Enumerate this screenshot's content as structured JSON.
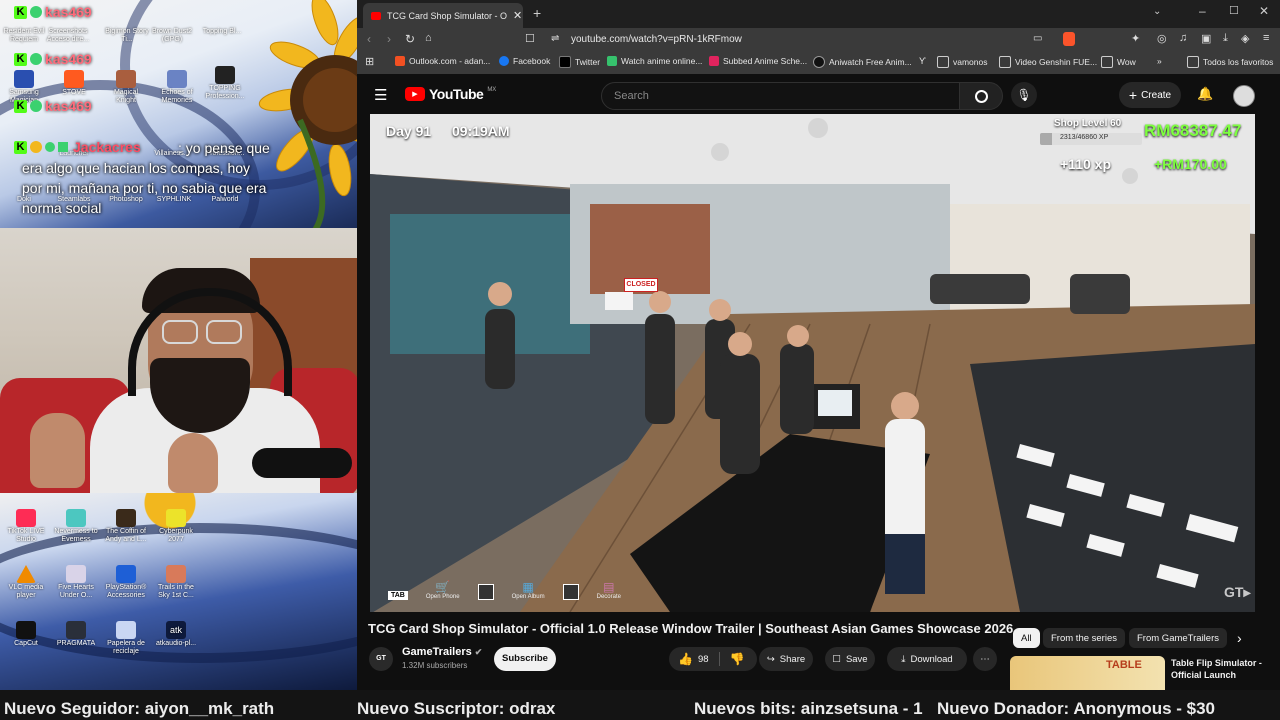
{
  "stream_overlay": {
    "chat": [
      {
        "badge": "K",
        "user": "kas469"
      },
      {
        "badge": "K",
        "user": "kas469"
      },
      {
        "badge": "K",
        "user": "kas469"
      },
      {
        "badge": "K",
        "user": "Jackacres",
        "message": ": yo pense que era algo que hacian los compas, hoy por mi, mañana por ti, no sabia que era norma social"
      }
    ],
    "desktop_icons_top": [
      "Resident Evil Requiem",
      "Screenshots Acceso dire...",
      "Bigimon Story Ti...",
      "Brown Dust2 (GPG)",
      "Topping Bl...",
      "Samsung Magician",
      "STOVE",
      "Magical Knight",
      "Echoes of Memories",
      "TOPPING Profession...",
      "Launcher",
      "Villainess...",
      "Profession...",
      "Doki",
      "Steamlabs",
      "Photoshop",
      "SYPHLINK",
      "Palworld"
    ],
    "desktop_icons_bottom": [
      "TikTok LIVE Studio",
      "Nevermess to Everness",
      "The Coffin of Andy and L...",
      "Cyberpunk 2077",
      "VLC media player",
      "Five Hearts Under O...",
      "PlayStation® Accessories",
      "Trails in the Sky 1st C...",
      "CapCut",
      "PRAGMATA",
      "Papelera de reciclaje",
      "atkaudio-pl..."
    ]
  },
  "browser": {
    "tab_title": "TCG Card Shop Simulator - Offic",
    "url": "youtube.com/watch?v=pRN-1kRFmow",
    "bookmarks": [
      "Outlook.com - adan...",
      "Facebook",
      "Twitter",
      "Watch anime online...",
      "Subbed Anime Sche...",
      "Aniwatch Free Anim...",
      "vamonos",
      "Video Genshin FUE...",
      "Wow"
    ],
    "bookmarks_right": "Todos los favoritos",
    "colors": {
      "youtube_red": "#ff0000",
      "game_green": "#7dff3f"
    }
  },
  "youtube": {
    "logo": "YouTube",
    "region": "MX",
    "search_placeholder": "Search",
    "create_label": "Create",
    "video": {
      "title": "TCG Card Shop Simulator - Official 1.0 Release Window Trailer | Southeast Asian Games Showcase 2026",
      "channel": "GameTrailers",
      "subscribers": "1.32M subscribers",
      "subscribe_label": "Subscribe",
      "likes": "98",
      "share_label": "Share",
      "save_label": "Save",
      "download_label": "Download",
      "watermark": "GT▸"
    },
    "game_hud": {
      "day": "Day 91",
      "time": "09:19AM",
      "shop_level": "Shop Level 60",
      "xp_progress": "2313/46860 XP",
      "money": "RM68387.47",
      "xp_gain": "+110 xp",
      "money_gain": "+RM170.00",
      "hud_buttons": [
        "TAB",
        "Open Phone",
        "",
        "Open Album",
        "",
        "Decorate"
      ],
      "closed_sign": "CLOSED"
    },
    "filter_chips": [
      "All",
      "From the series",
      "From GameTrailers"
    ],
    "recommended": {
      "title": "Table Flip Simulator - Official Launch",
      "thumb_text": "TABLE"
    }
  },
  "ticker": [
    "Nuevo Seguidor: aiyon__mk_rath",
    "Nuevo Suscriptor: odrax",
    "Nuevos bits: ainzsetsuna - 1",
    "Nuevo Donador: Anonymous - $30"
  ]
}
